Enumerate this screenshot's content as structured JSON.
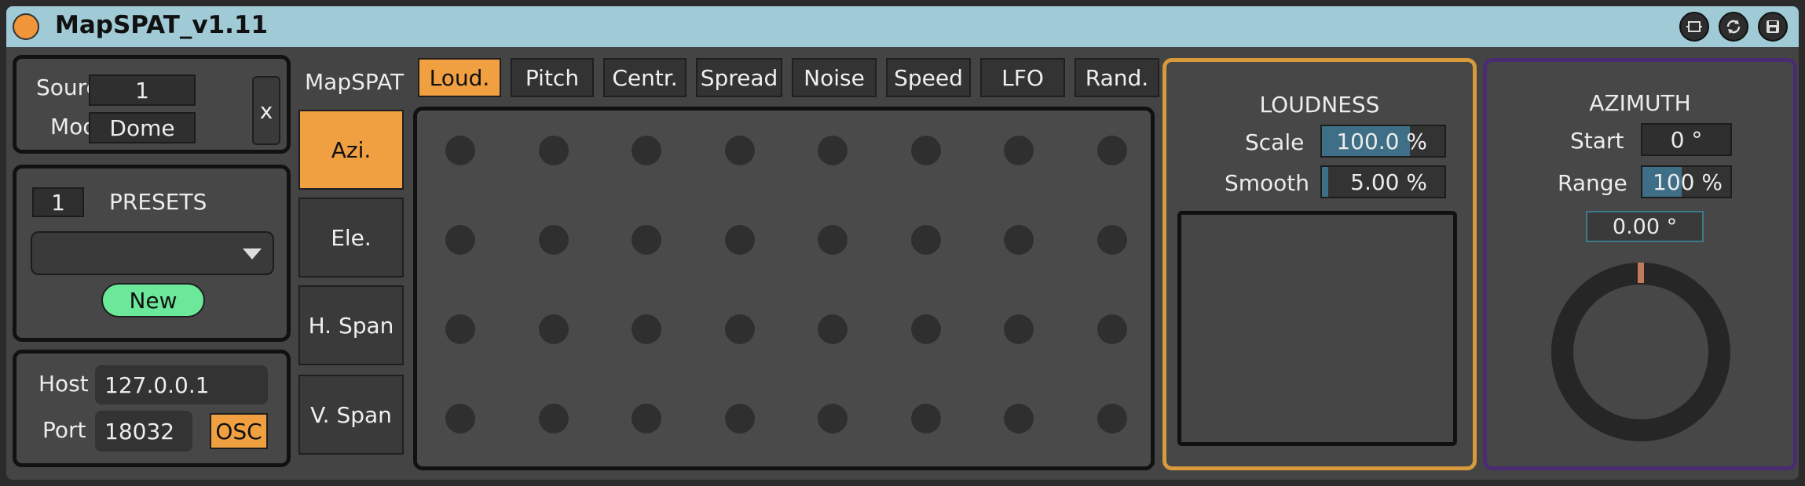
{
  "window": {
    "title": "MapSPAT_v1.11"
  },
  "source_panel": {
    "source_label": "Source",
    "source_value": "1",
    "mode_label": "Mode",
    "mode_value": "Dome",
    "close_label": "x"
  },
  "presets_panel": {
    "preset_number": "1",
    "title": "PRESETS",
    "dropdown_value": "",
    "new_label": "New"
  },
  "osc_panel": {
    "host_label": "Host",
    "host_value": "127.0.0.1",
    "port_label": "Port",
    "port_value": "18032",
    "osc_label": "OSC"
  },
  "tabs": {
    "heading": "MapSPAT",
    "items": [
      {
        "label": "Loud.",
        "active": true
      },
      {
        "label": "Pitch",
        "active": false
      },
      {
        "label": "Centr.",
        "active": false
      },
      {
        "label": "Spread",
        "active": false
      },
      {
        "label": "Noise",
        "active": false
      },
      {
        "label": "Speed",
        "active": false
      },
      {
        "label": "LFO",
        "active": false
      },
      {
        "label": "Rand.",
        "active": false
      }
    ]
  },
  "params": {
    "items": [
      {
        "label": "Azi.",
        "active": true
      },
      {
        "label": "Ele.",
        "active": false
      },
      {
        "label": "H. Span",
        "active": false
      },
      {
        "label": "V. Span",
        "active": false
      }
    ]
  },
  "matrix": {
    "rows": 4,
    "cols": 8
  },
  "loudness": {
    "title": "LOUDNESS",
    "scale_label": "Scale",
    "scale_value": "100.0 %",
    "scale_fraction": 1.0,
    "smooth_label": "Smooth",
    "smooth_value": "5.00 %",
    "smooth_fraction": 0.05
  },
  "azimuth": {
    "title": "AZIMUTH",
    "start_label": "Start",
    "start_value": "0 °",
    "range_label": "Range",
    "range_value": "100 %",
    "range_fraction": 1.0,
    "angle_value": "0.00 °"
  },
  "colors": {
    "accent_orange": "#f0a040",
    "title_bar": "#9fcad6",
    "loudness_border": "#d99a3c",
    "azimuth_border": "#4a2a70",
    "new_button": "#6be89a",
    "slider_fill": "#3e6f86"
  }
}
